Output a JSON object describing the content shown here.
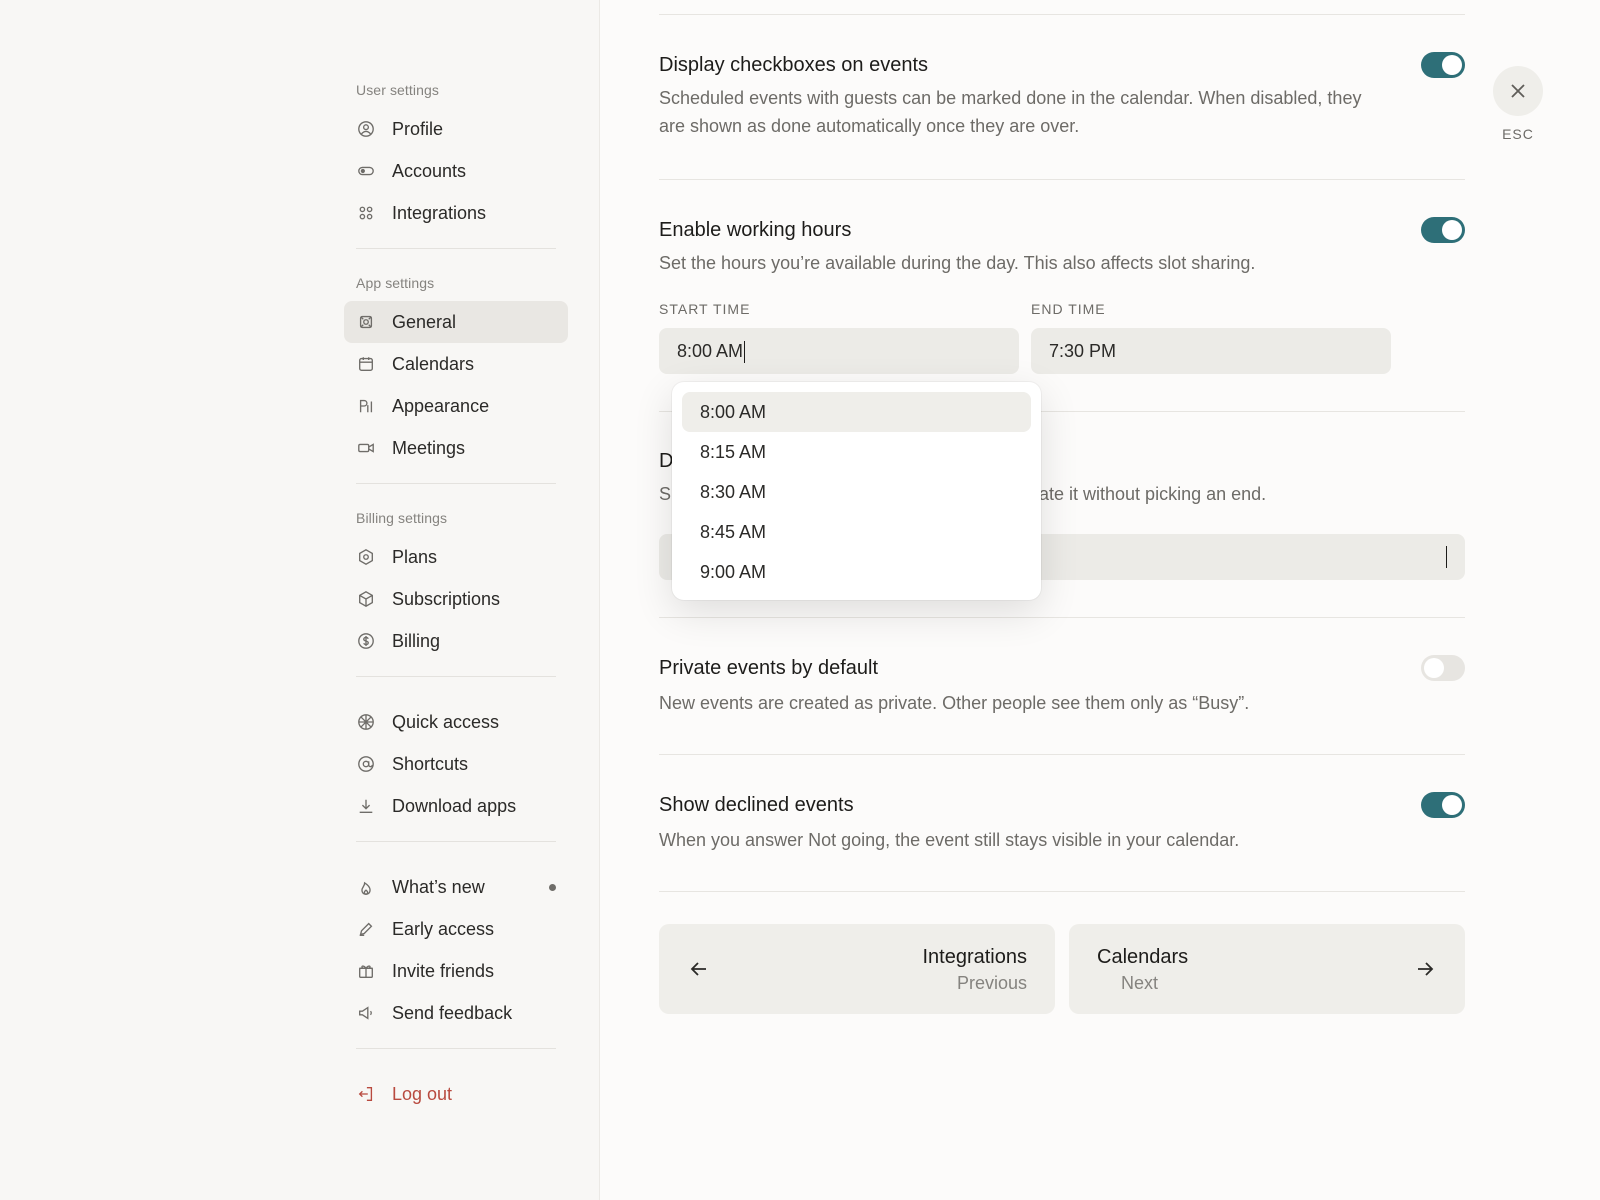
{
  "sidebar": {
    "user_settings": {
      "label": "User settings",
      "items": [
        {
          "label": "Profile",
          "icon": "user-circle-icon"
        },
        {
          "label": "Accounts",
          "icon": "toggle-icon"
        },
        {
          "label": "Integrations",
          "icon": "grid-icon"
        }
      ]
    },
    "app_settings": {
      "label": "App settings",
      "items": [
        {
          "label": "General",
          "icon": "general-icon",
          "active": true
        },
        {
          "label": "Calendars",
          "icon": "calendar-icon"
        },
        {
          "label": "Appearance",
          "icon": "typography-icon"
        },
        {
          "label": "Meetings",
          "icon": "video-icon"
        }
      ]
    },
    "billing_settings": {
      "label": "Billing settings",
      "items": [
        {
          "label": "Plans",
          "icon": "hexagon-icon"
        },
        {
          "label": "Subscriptions",
          "icon": "box-icon"
        },
        {
          "label": "Billing",
          "icon": "dollar-circle-icon"
        }
      ]
    },
    "misc": [
      {
        "label": "Quick access",
        "icon": "aperture-icon"
      },
      {
        "label": "Shortcuts",
        "icon": "at-sign-icon"
      },
      {
        "label": "Download apps",
        "icon": "download-icon"
      }
    ],
    "community": [
      {
        "label": "What’s new",
        "icon": "flame-icon",
        "has_dot": true
      },
      {
        "label": "Early access",
        "icon": "pen-icon"
      },
      {
        "label": "Invite friends",
        "icon": "gift-icon"
      },
      {
        "label": "Send feedback",
        "icon": "megaphone-icon"
      }
    ],
    "logout": {
      "label": "Log out",
      "icon": "logout-icon",
      "color": "#b84a3f"
    }
  },
  "settings": {
    "checkboxes": {
      "title": "Display checkboxes on events",
      "desc": "Scheduled events with guests can be marked done in the calendar. When disabled, they are shown as done automatically once they are over.",
      "enabled": true
    },
    "working_hours": {
      "title": "Enable working hours",
      "desc": "Set the hours you’re available during the day. This also affects slot sharing.",
      "enabled": true,
      "start_label": "START TIME",
      "start_value": "8:00 AM",
      "end_label": "END TIME",
      "end_value": "7:30 PM"
    },
    "covered": {
      "title_fragment": "D",
      "desc_fragment_left": "S",
      "desc_fragment_right": "ate it without picking an end."
    },
    "private": {
      "title": "Private events by default",
      "desc": "New events are created as private. Other people see them only as “Busy”.",
      "enabled": false
    },
    "declined": {
      "title": "Show declined events",
      "desc": "When you answer Not going, the event still stays visible in your calendar.",
      "enabled": true
    }
  },
  "dropdown": {
    "options": [
      "8:00 AM",
      "8:15 AM",
      "8:30 AM",
      "8:45 AM",
      "9:00 AM"
    ],
    "selected": "8:00 AM"
  },
  "pagination": {
    "previous": {
      "title": "Integrations",
      "sub": "Previous"
    },
    "next": {
      "title": "Calendars",
      "sub": "Next"
    }
  },
  "close": {
    "label": "ESC"
  },
  "colors": {
    "accent": "#2e6f78",
    "danger": "#b84a3f"
  }
}
